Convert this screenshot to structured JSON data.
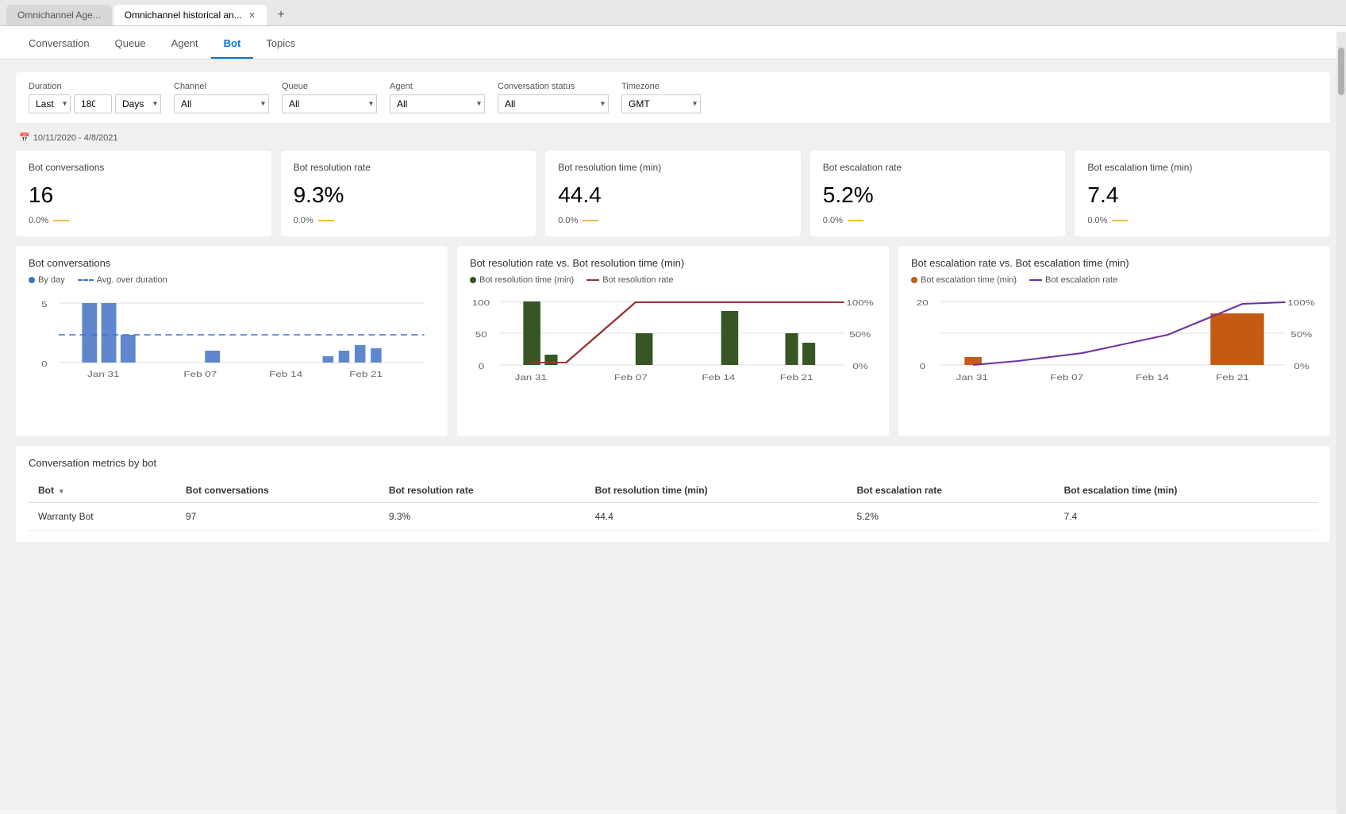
{
  "browser": {
    "tabs": [
      {
        "id": "tab1",
        "label": "Omnichannel Age...",
        "active": false
      },
      {
        "id": "tab2",
        "label": "Omnichannel historical an...",
        "active": true
      }
    ],
    "new_tab_label": "+"
  },
  "nav": {
    "items": [
      {
        "id": "conversation",
        "label": "Conversation",
        "active": false
      },
      {
        "id": "queue",
        "label": "Queue",
        "active": false
      },
      {
        "id": "agent",
        "label": "Agent",
        "active": false
      },
      {
        "id": "bot",
        "label": "Bot",
        "active": true
      },
      {
        "id": "topics",
        "label": "Topics",
        "active": false
      }
    ]
  },
  "filters": {
    "duration_label": "Duration",
    "duration_last": "Last",
    "duration_value": "180",
    "duration_unit": "Days",
    "channel_label": "Channel",
    "channel_value": "All",
    "queue_label": "Queue",
    "queue_value": "All",
    "agent_label": "Agent",
    "agent_value": "All",
    "conv_status_label": "Conversation status",
    "conv_status_value": "All",
    "timezone_label": "Timezone",
    "timezone_value": "GMT",
    "date_range": "10/11/2020 - 4/8/2021"
  },
  "kpis": [
    {
      "id": "bot-conversations",
      "title": "Bot conversations",
      "value": "16",
      "change": "0.0%"
    },
    {
      "id": "bot-resolution-rate",
      "title": "Bot resolution rate",
      "value": "9.3%",
      "change": "0.0%"
    },
    {
      "id": "bot-resolution-time",
      "title": "Bot resolution time (min)",
      "value": "44.4",
      "change": "0.0%"
    },
    {
      "id": "bot-escalation-rate",
      "title": "Bot escalation rate",
      "value": "5.2%",
      "change": "0.0%"
    },
    {
      "id": "bot-escalation-time",
      "title": "Bot escalation time (min)",
      "value": "7.4",
      "change": "0.0%"
    }
  ],
  "charts": {
    "bot_conversations": {
      "title": "Bot conversations",
      "legend": [
        {
          "type": "dot",
          "color": "#4472c4",
          "label": "By day"
        },
        {
          "type": "dash",
          "color": "#4472c4",
          "label": "Avg. over duration"
        }
      ],
      "x_labels": [
        "Jan 31",
        "Feb 07",
        "Feb 14",
        "Feb 21"
      ],
      "y_max": "5",
      "y_min": "0"
    },
    "resolution_rate_time": {
      "title": "Bot resolution rate vs. Bot resolution time (min)",
      "legend": [
        {
          "type": "dot",
          "color": "#375623",
          "label": "Bot resolution time (min)"
        },
        {
          "type": "line",
          "color": "#943634",
          "label": "Bot resolution rate"
        }
      ],
      "x_labels": [
        "Jan 31",
        "Feb 07",
        "Feb 14",
        "Feb 21"
      ],
      "y_left_max": "100",
      "y_left_mid": "50",
      "y_left_min": "0",
      "y_right_max": "100%",
      "y_right_mid": "50%",
      "y_right_min": "0%"
    },
    "escalation_rate_time": {
      "title": "Bot escalation rate vs. Bot escalation time (min)",
      "legend": [
        {
          "type": "dot",
          "color": "#c55a11",
          "label": "Bot escalation time (min)"
        },
        {
          "type": "line",
          "color": "#7030a0",
          "label": "Bot escalation rate"
        }
      ],
      "x_labels": [
        "Jan 31",
        "Feb 07",
        "Feb 14",
        "Feb 21"
      ],
      "y_left_max": "20",
      "y_right_max": "100%",
      "y_right_mid": "50%",
      "y_right_min": "0%"
    }
  },
  "table": {
    "title": "Conversation metrics by bot",
    "headers": [
      "Bot",
      "Bot conversations",
      "Bot resolution rate",
      "Bot resolution time (min)",
      "Bot escalation rate",
      "Bot escalation time (min)"
    ],
    "rows": [
      {
        "bot": "Warranty Bot",
        "conversations": "97",
        "resolution_rate": "9.3%",
        "resolution_time": "44.4",
        "escalation_rate": "5.2%",
        "escalation_time": "7.4"
      }
    ]
  }
}
